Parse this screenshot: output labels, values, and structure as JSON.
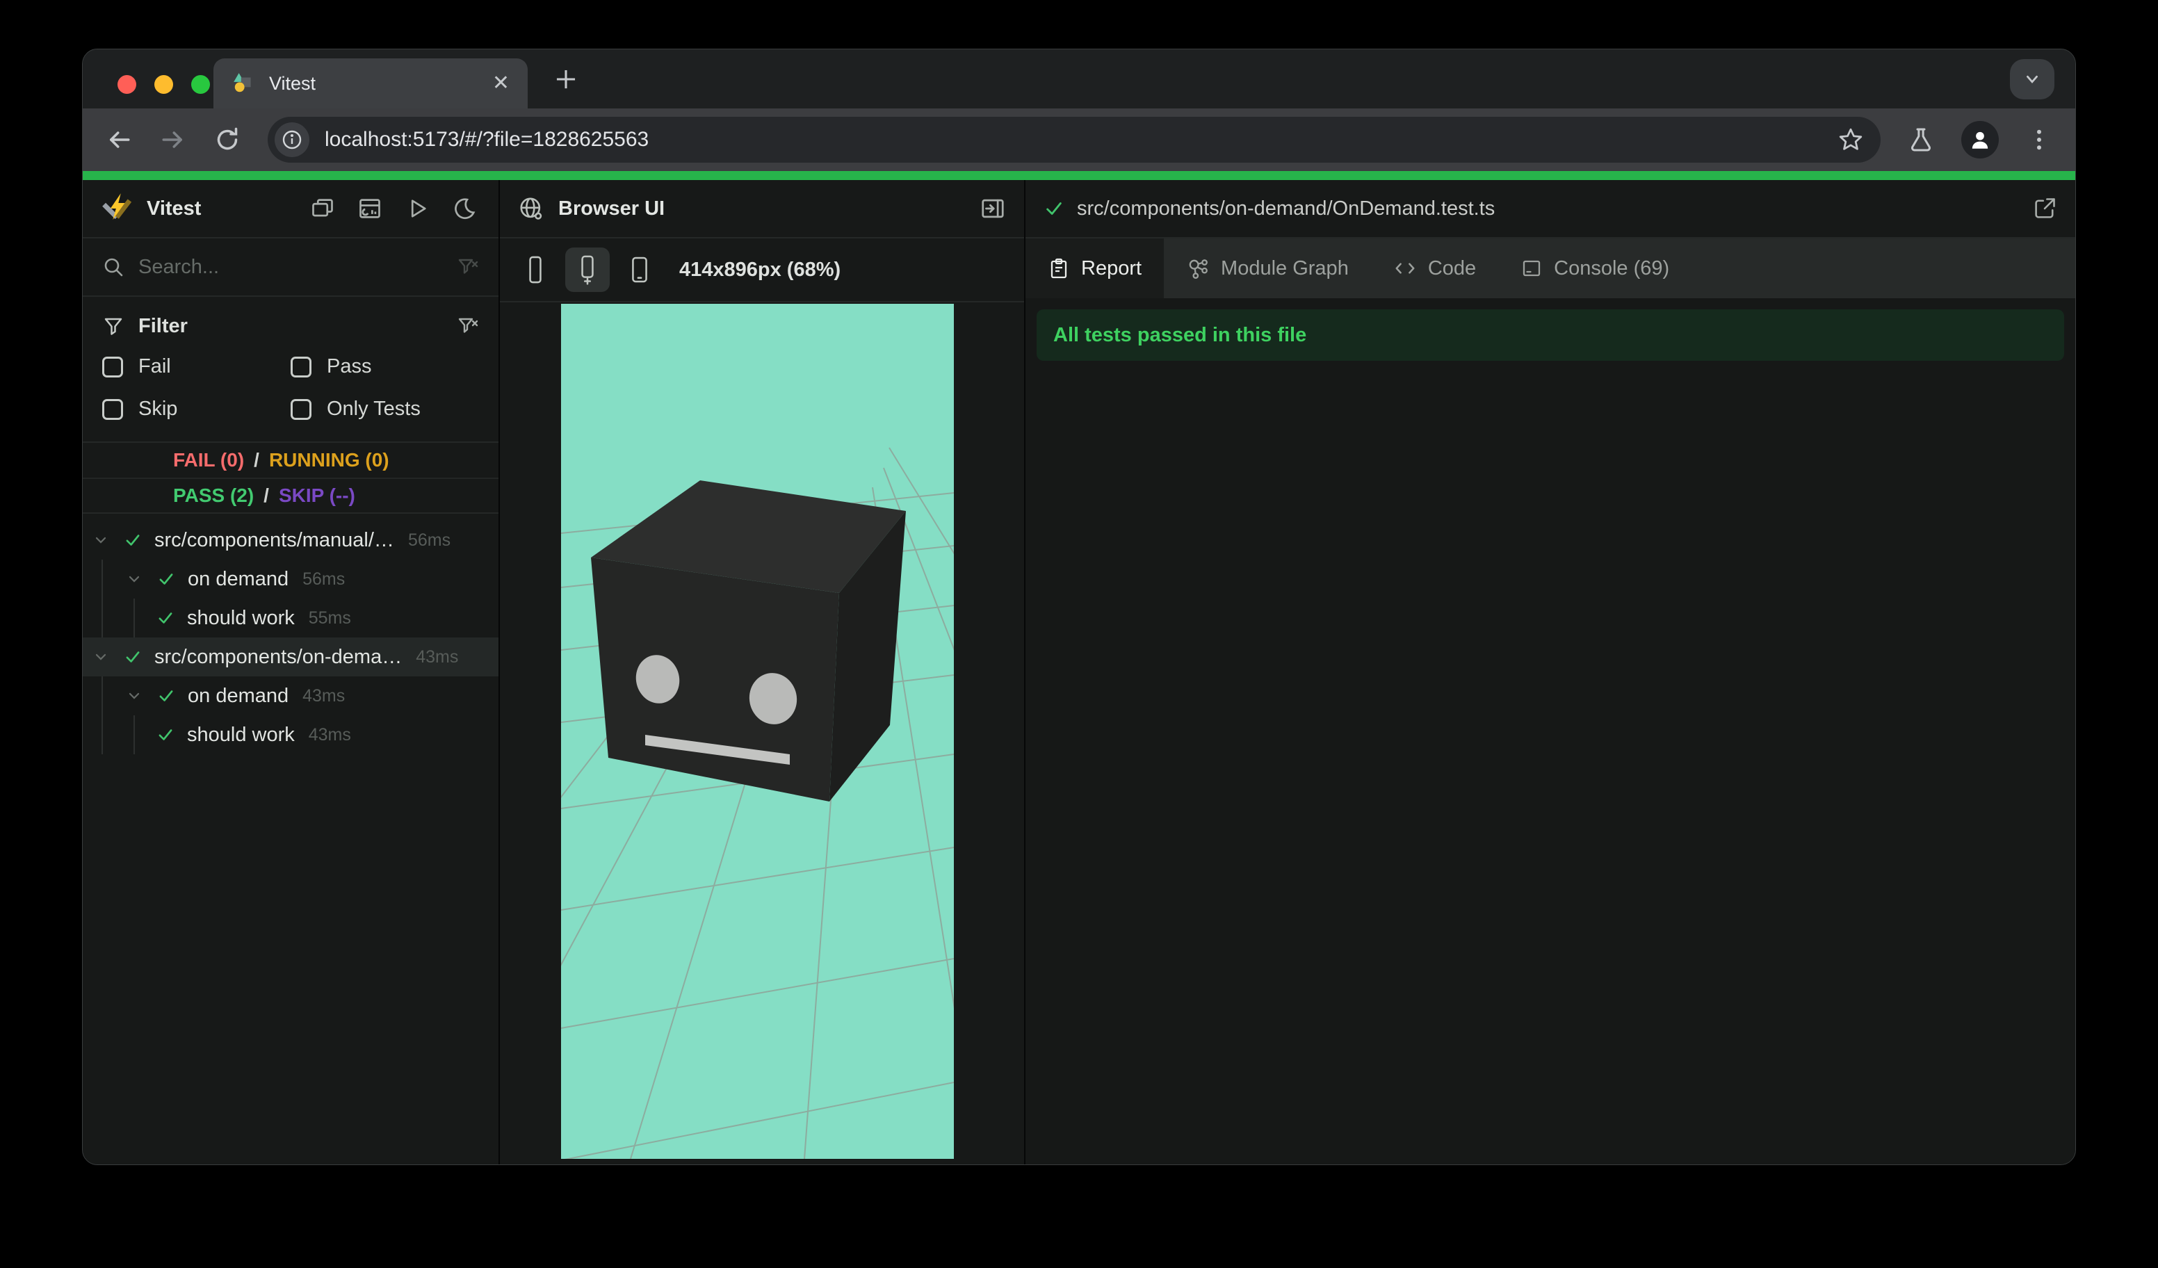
{
  "chrome": {
    "tab_title": "Vitest",
    "url": "localhost:5173/#/?file=1828625563",
    "close_glyph": "✕",
    "new_tab_glyph": "+"
  },
  "sidebar": {
    "title": "Vitest",
    "search": {
      "placeholder": "Search..."
    },
    "filter": {
      "title": "Filter",
      "options": [
        {
          "label": "Fail"
        },
        {
          "label": "Pass"
        },
        {
          "label": "Skip"
        },
        {
          "label": "Only Tests"
        }
      ]
    },
    "stats": {
      "fail": "FAIL (0)",
      "sep1": "/",
      "running": "RUNNING (0)",
      "pass": "PASS (2)",
      "sep2": "/",
      "skip": "SKIP (--)"
    },
    "tree": [
      {
        "name": "src/components/manual/…",
        "time": "56ms"
      },
      {
        "name": "on demand",
        "time": "56ms"
      },
      {
        "name": "should work",
        "time": "55ms"
      },
      {
        "name": "src/components/on-dema…",
        "time": "43ms"
      },
      {
        "name": "on demand",
        "time": "43ms"
      },
      {
        "name": "should work",
        "time": "43ms"
      }
    ]
  },
  "browser_panel": {
    "title": "Browser UI",
    "viewport": "414x896px (68%)"
  },
  "report_panel": {
    "file": "src/components/on-demand/OnDemand.test.ts",
    "tabs": [
      {
        "label": "Report"
      },
      {
        "label": "Module Graph"
      },
      {
        "label": "Code"
      },
      {
        "label": "Console (69)"
      }
    ],
    "banner": "All tests passed in this file"
  },
  "colors": {
    "accent_green_bar": "#27b44b",
    "pass": "#42ca70",
    "fail": "#f56c6c",
    "running": "#dda11d",
    "skip": "#7a49c4",
    "banner_bg": "#152a1d",
    "banner_text": "#3ed160",
    "preview_bg": "#85dec5",
    "cube_top": "#2d2e2d",
    "cube_front": "#252625",
    "cube_side": "#1d1e1d",
    "eyes": "#b9bab8"
  }
}
